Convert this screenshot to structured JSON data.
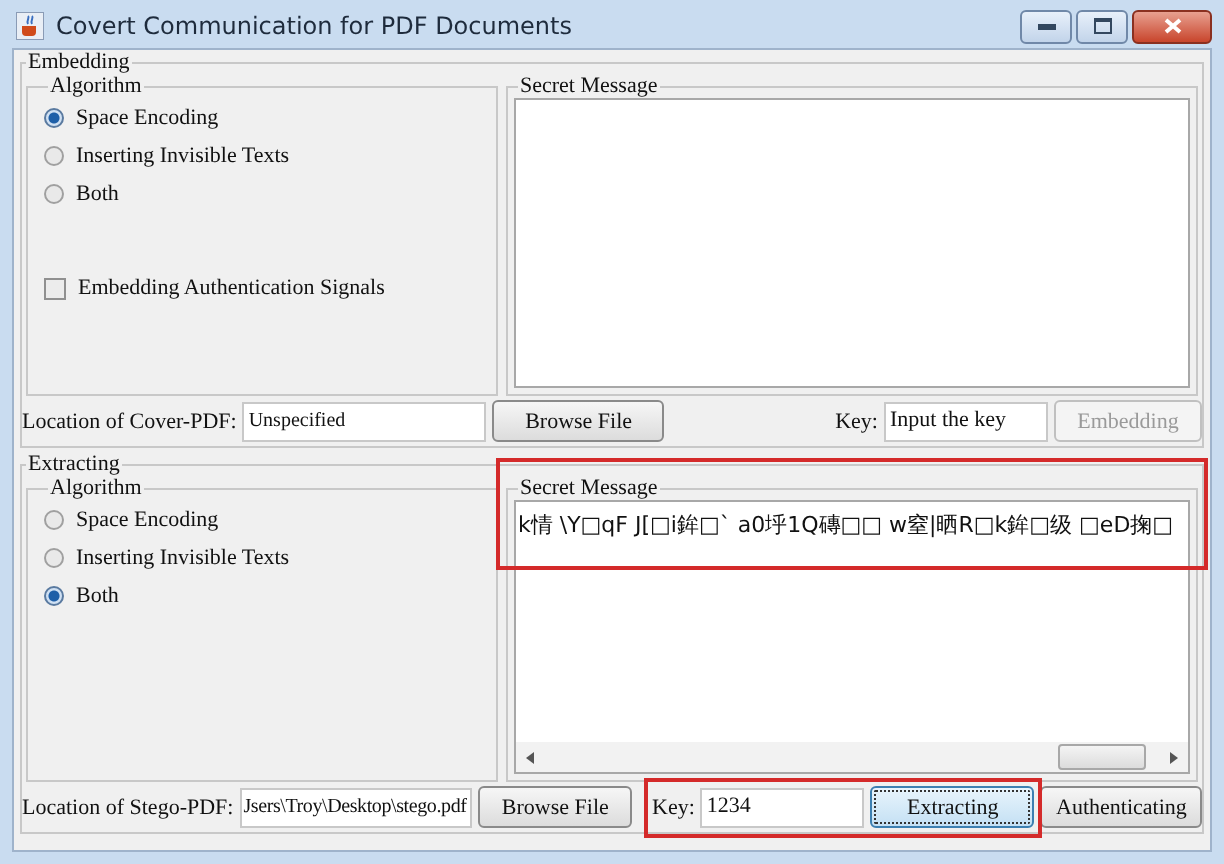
{
  "window": {
    "title": "Covert Communication for PDF Documents"
  },
  "embedding": {
    "title": "Embedding",
    "algorithm": {
      "title": "Algorithm",
      "options": [
        {
          "label": "Space Encoding",
          "selected": true
        },
        {
          "label": "Inserting Invisible Texts",
          "selected": false
        },
        {
          "label": "Both",
          "selected": false
        }
      ]
    },
    "auth_checkbox": {
      "label": "Embedding Authentication Signals",
      "checked": false
    },
    "secret_message": {
      "title": "Secret Message"
    },
    "location": {
      "label": "Location of Cover-PDF:",
      "value": "Unspecified"
    },
    "browse_button": "Browse File",
    "key": {
      "label": "Key:",
      "value": "Input the key"
    },
    "buttons": [
      {
        "label": "Embedding",
        "disabled": true,
        "focused": false
      }
    ]
  },
  "extracting": {
    "title": "Extracting",
    "algorithm": {
      "title": "Algorithm",
      "options": [
        {
          "label": "Space Encoding",
          "selected": false
        },
        {
          "label": "Inserting Invisible Texts",
          "selected": false
        },
        {
          "label": "Both",
          "selected": true
        }
      ]
    },
    "secret_message": {
      "title": "Secret Message",
      "value": "k情 \\Y□qF J[□i鉾□` a0垀1Q磚□□ w窒|晒R□k鉾□级 □eD掬□"
    },
    "location": {
      "label": "Location of Stego-PDF:",
      "value": "Jsers\\Troy\\Desktop\\stego.pdf"
    },
    "browse_button": "Browse File",
    "key": {
      "label": "Key:",
      "value": "1234"
    },
    "buttons": [
      {
        "label": "Extracting",
        "disabled": false,
        "focused": true
      },
      {
        "label": "Authenticating",
        "disabled": false,
        "focused": false
      }
    ]
  }
}
